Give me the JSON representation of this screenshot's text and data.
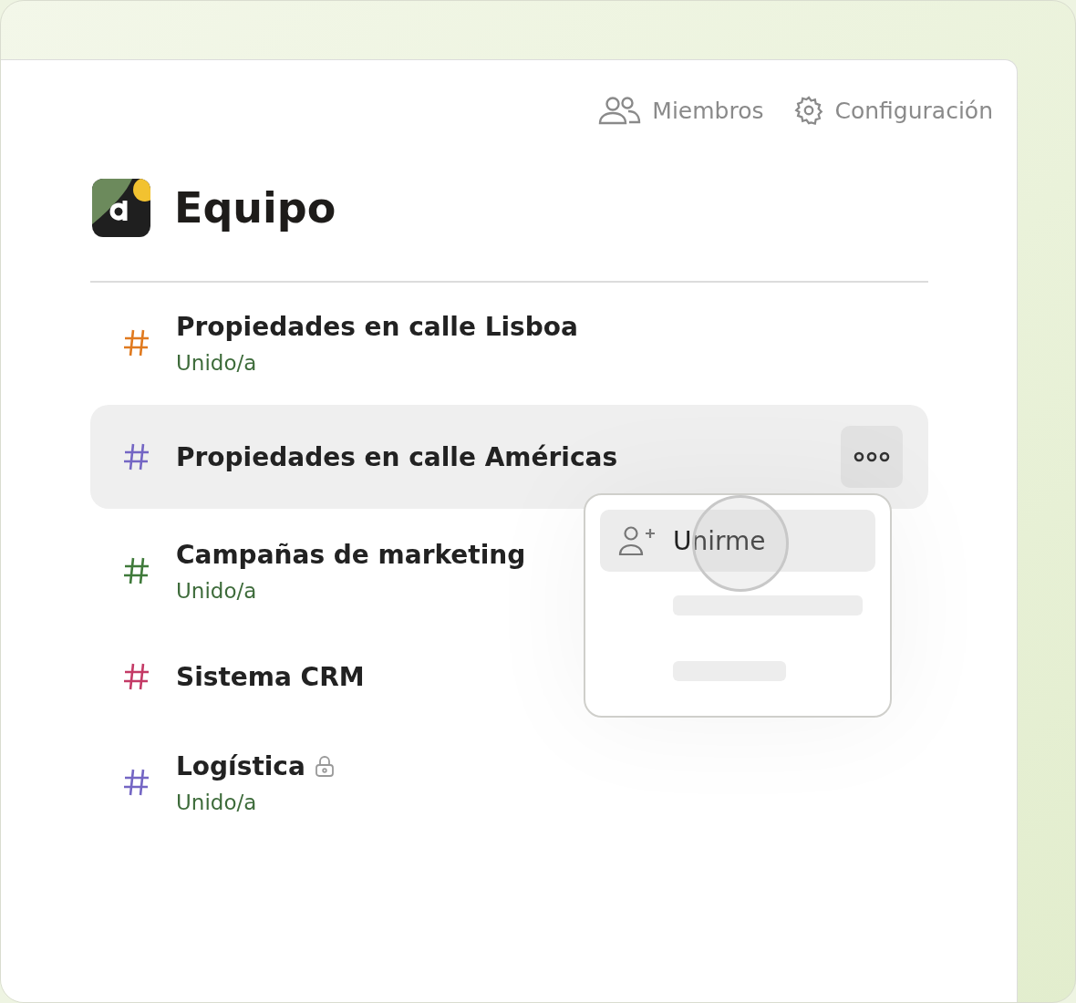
{
  "header_links": [
    {
      "kind": "members",
      "label": "Miembros"
    },
    {
      "kind": "settings",
      "label": "Configuración"
    }
  ],
  "workspace": {
    "title": "Equipo"
  },
  "channels": [
    {
      "name": "Propiedades en calle Lisboa",
      "color": "#e07a1f",
      "status": "Unido/a",
      "locked": false,
      "selected": false
    },
    {
      "name": "Propiedades en calle Américas",
      "color": "#7466c4",
      "locked": false,
      "selected": true
    },
    {
      "name": "Campañas de marketing",
      "color": "#3f7a3a",
      "status": "Unido/a",
      "locked": false,
      "selected": false
    },
    {
      "name": "Sistema CRM",
      "color": "#c43a66",
      "locked": false,
      "selected": false
    },
    {
      "name": "Logística",
      "color": "#7466c4",
      "status": "Unido/a",
      "locked": true,
      "selected": false
    }
  ],
  "menu": {
    "items": [
      {
        "kind": "action",
        "label": "Unirme",
        "selected": true
      },
      {
        "kind": "skeleton_long"
      },
      {
        "kind": "skeleton_short"
      }
    ]
  }
}
